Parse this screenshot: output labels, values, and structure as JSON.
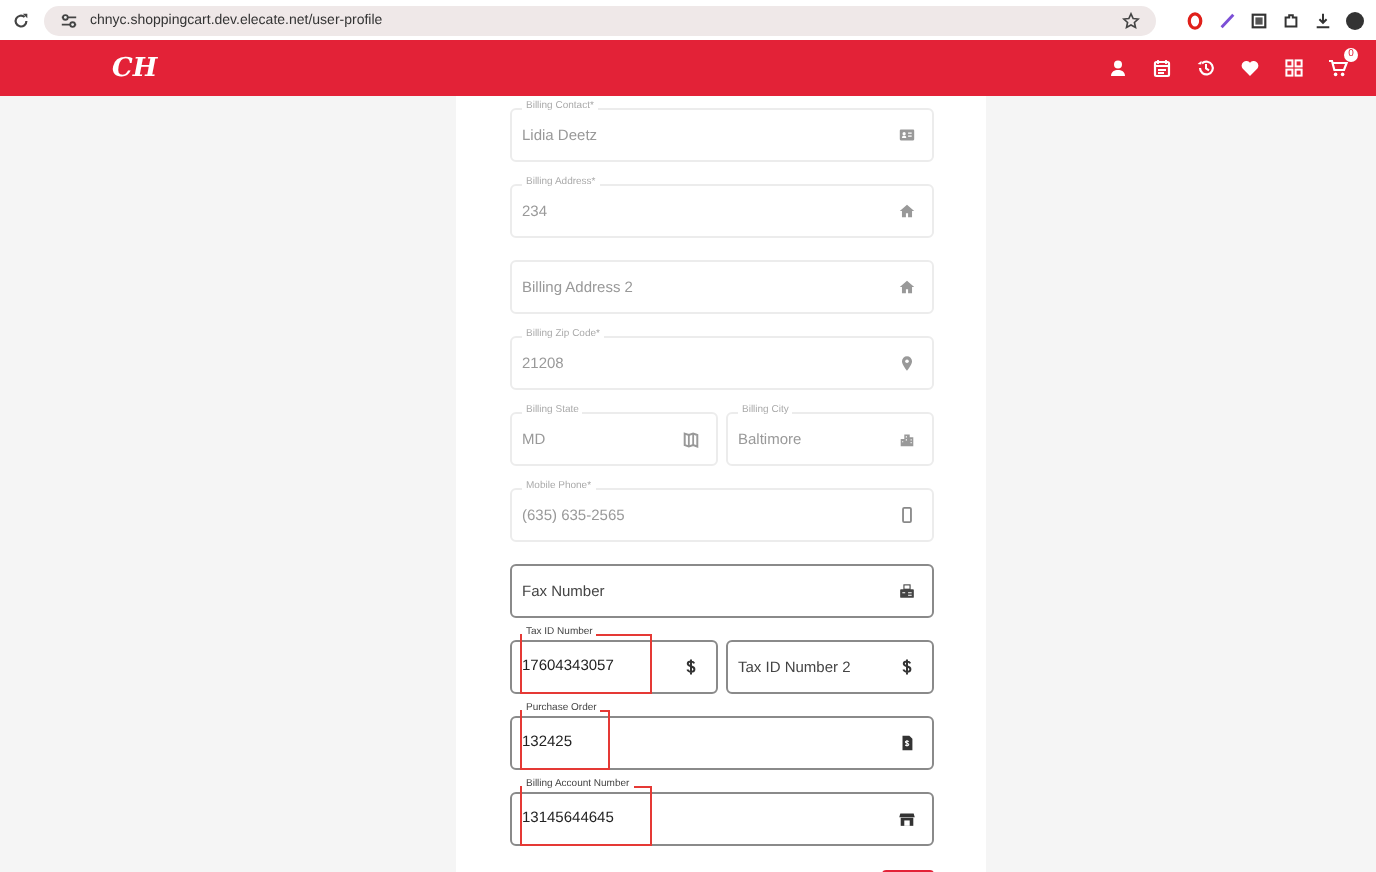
{
  "browser": {
    "url": "chnyc.shoppingcart.dev.elecate.net/user-profile"
  },
  "header": {
    "logo": "CH",
    "cart_badge": "0"
  },
  "fields": [
    {
      "kind": "single",
      "label": "Billing Contact*",
      "value": "Lidia Deetz",
      "disabled": true,
      "annotated": false
    },
    {
      "kind": "single",
      "label": "Billing Address*",
      "value": "234",
      "disabled": true,
      "annotated": false
    },
    {
      "kind": "single",
      "placeholder": "Billing Address 2",
      "disabled": true,
      "annotated": false
    },
    {
      "kind": "single",
      "label": "Billing Zip Code*",
      "value": "21208",
      "disabled": true,
      "annotated": false
    },
    {
      "kind": "pair",
      "items": [
        {
          "label": "Billing State",
          "value": "MD",
          "disabled": true,
          "annotated": false
        },
        {
          "label": "Billing City",
          "value": "Baltimore",
          "disabled": true,
          "annotated": false
        }
      ]
    },
    {
      "kind": "single",
      "label": "Mobile Phone*",
      "value": "(635) 635-2565",
      "disabled": true,
      "annotated": false
    },
    {
      "kind": "single",
      "placeholder": "Fax Number",
      "disabled": false,
      "annotated": false
    },
    {
      "kind": "pair",
      "items": [
        {
          "label": "Tax ID Number",
          "value": "17604343057",
          "disabled": false,
          "annotated": true
        },
        {
          "placeholder": "Tax ID Number 2",
          "disabled": false,
          "annotated": false
        }
      ]
    },
    {
      "kind": "single",
      "label": "Purchase Order",
      "value": "132425",
      "disabled": false,
      "annotated": true
    },
    {
      "kind": "single",
      "label": "Billing Account Number",
      "value": "13145644645",
      "disabled": false,
      "annotated": true
    }
  ]
}
